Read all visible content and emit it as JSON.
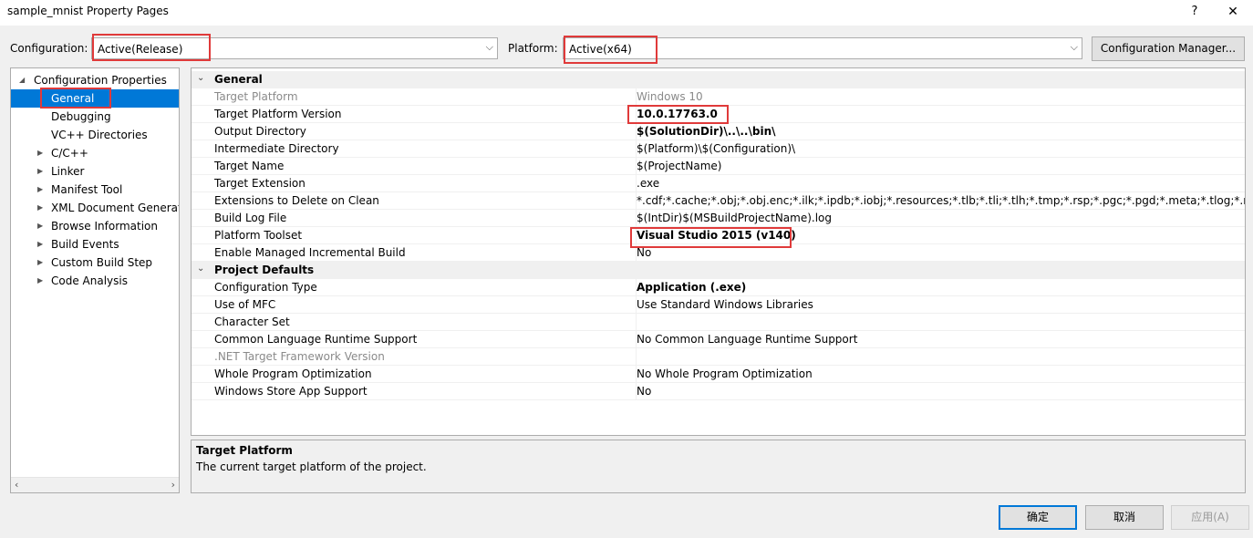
{
  "window": {
    "title": "sample_mnist Property Pages",
    "help_label": "?",
    "close_label": "✕"
  },
  "toolbar": {
    "configuration_label": "Configuration:",
    "configuration_value": "Active(Release)",
    "platform_label": "Platform:",
    "platform_value": "Active(x64)",
    "config_manager_label": "Configuration Manager..."
  },
  "tree": {
    "root": "Configuration Properties",
    "items": [
      {
        "label": "General",
        "expandable": false,
        "selected": true
      },
      {
        "label": "Debugging",
        "expandable": false
      },
      {
        "label": "VC++ Directories",
        "expandable": false
      },
      {
        "label": "C/C++",
        "expandable": true
      },
      {
        "label": "Linker",
        "expandable": true
      },
      {
        "label": "Manifest Tool",
        "expandable": true
      },
      {
        "label": "XML Document Generator",
        "expandable": true
      },
      {
        "label": "Browse Information",
        "expandable": true
      },
      {
        "label": "Build Events",
        "expandable": true
      },
      {
        "label": "Custom Build Step",
        "expandable": true
      },
      {
        "label": "Code Analysis",
        "expandable": true
      }
    ]
  },
  "grid": {
    "categories": [
      {
        "name": "General",
        "rows": [
          {
            "name": "Target Platform",
            "value": "Windows 10",
            "dim": true
          },
          {
            "name": "Target Platform Version",
            "value": "10.0.17763.0",
            "bold": true
          },
          {
            "name": "Output Directory",
            "value": "$(SolutionDir)\\..\\..\\bin\\",
            "bold": true
          },
          {
            "name": "Intermediate Directory",
            "value": "$(Platform)\\$(Configuration)\\"
          },
          {
            "name": "Target Name",
            "value": "$(ProjectName)"
          },
          {
            "name": "Target Extension",
            "value": ".exe"
          },
          {
            "name": "Extensions to Delete on Clean",
            "value": "*.cdf;*.cache;*.obj;*.obj.enc;*.ilk;*.ipdb;*.iobj;*.resources;*.tlb;*.tli;*.tlh;*.tmp;*.rsp;*.pgc;*.pgd;*.meta;*.tlog;*.manifest;*.res;*.pch;*.exp;*.idb;*.rep;*.xdc;*.pdb;*_manifest.rc;*.bsc;*.sbr;*.xml;*.metagen;*.bi"
          },
          {
            "name": "Build Log File",
            "value": "$(IntDir)$(MSBuildProjectName).log"
          },
          {
            "name": "Platform Toolset",
            "value": "Visual Studio 2015 (v140)",
            "bold": true
          },
          {
            "name": "Enable Managed Incremental Build",
            "value": "No"
          }
        ]
      },
      {
        "name": "Project Defaults",
        "rows": [
          {
            "name": "Configuration Type",
            "value": "Application (.exe)",
            "bold": true
          },
          {
            "name": "Use of MFC",
            "value": "Use Standard Windows Libraries"
          },
          {
            "name": "Character Set",
            "value": ""
          },
          {
            "name": "Common Language Runtime Support",
            "value": "No Common Language Runtime Support"
          },
          {
            "name": ".NET Target Framework Version",
            "value": "",
            "dim": true
          },
          {
            "name": "Whole Program Optimization",
            "value": "No Whole Program Optimization"
          },
          {
            "name": "Windows Store App Support",
            "value": "No"
          }
        ]
      }
    ]
  },
  "description": {
    "title": "Target Platform",
    "text": "The current target platform of the project."
  },
  "buttons": {
    "ok": "确定",
    "cancel": "取消",
    "apply": "应用(A)"
  },
  "colors": {
    "selection": "#0078d7",
    "highlight_box": "#e03a3a"
  }
}
